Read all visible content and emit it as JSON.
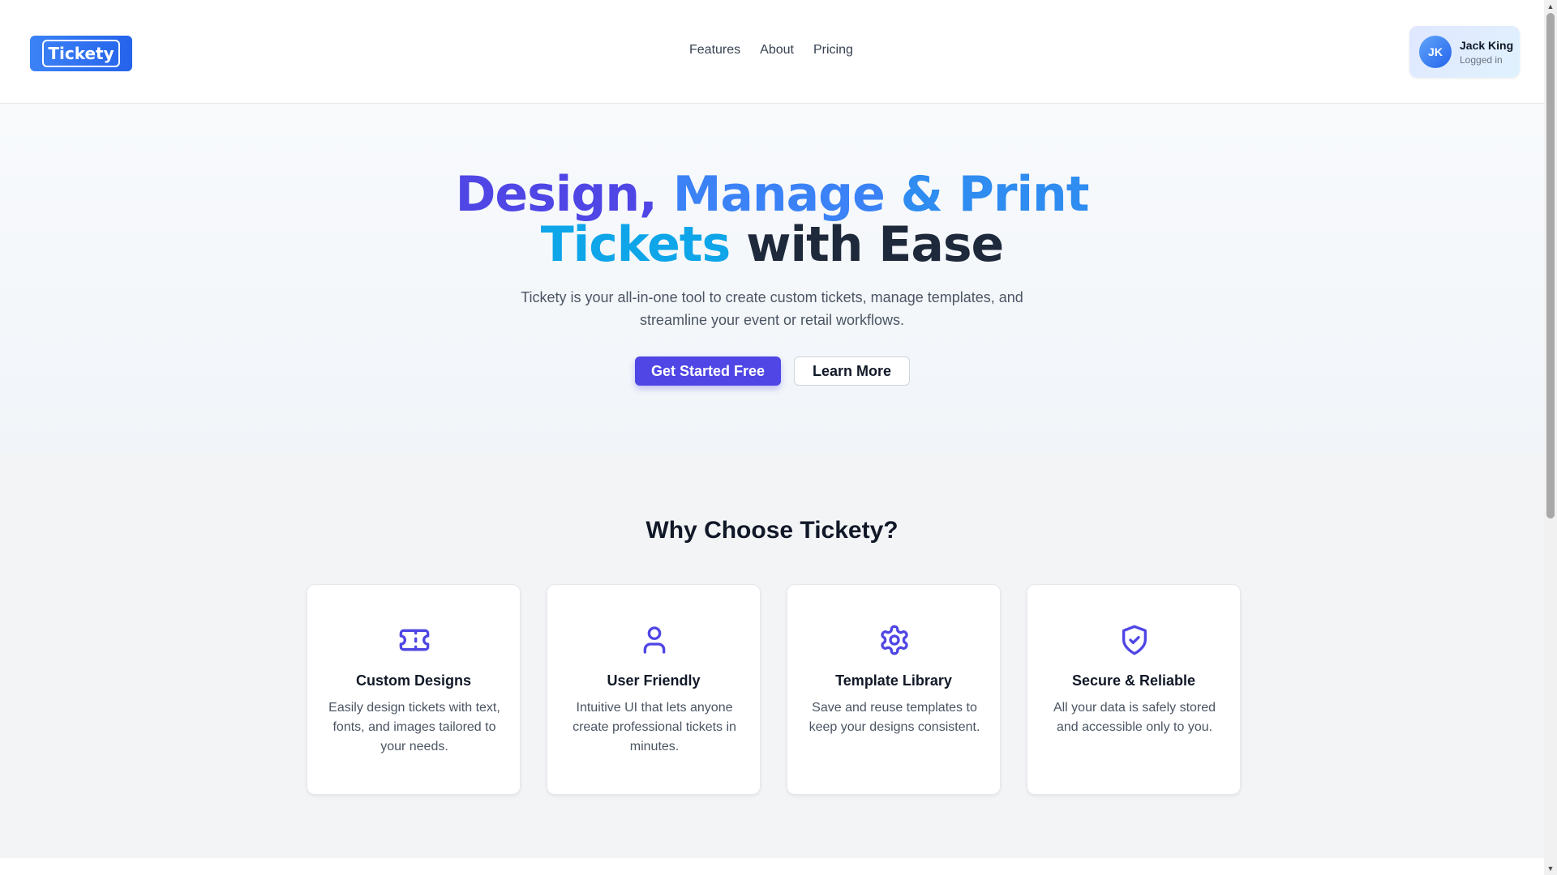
{
  "header": {
    "logo_text": "Tickety",
    "nav": [
      "Features",
      "About",
      "Pricing"
    ],
    "user": {
      "initials": "JK",
      "name": "Jack King",
      "status": "Logged in"
    }
  },
  "hero": {
    "title_parts": {
      "w1": "Design,",
      "w2": "Manage",
      "w3": "&",
      "w4": "Print",
      "w5": "Tickets",
      "w6": "with Ease"
    },
    "subtitle_line1": "Tickety is your all-in-one tool to create custom tickets, manage templates, and",
    "subtitle_line2": "streamline your event or retail workflows.",
    "primary_button": "Get Started Free",
    "secondary_button": "Learn More"
  },
  "features": {
    "title": "Why Choose Tickety?",
    "cards": [
      {
        "icon": "ticket-icon",
        "title": "Custom Designs",
        "desc": "Easily design tickets with text, fonts, and images tailored to your needs."
      },
      {
        "icon": "user-icon",
        "title": "User Friendly",
        "desc": "Intuitive UI that lets anyone create professional tickets in minutes."
      },
      {
        "icon": "gear-icon",
        "title": "Template Library",
        "desc": "Save and reuse templates to keep your designs consistent."
      },
      {
        "icon": "shield-check-icon",
        "title": "Secure & Reliable",
        "desc": "All your data is safely stored and accessible only to you."
      }
    ]
  },
  "colors": {
    "accent": "#4f46e5",
    "blue": "#3b82f6",
    "cyan": "#0ea5e9",
    "text_dark": "#1e293b"
  }
}
